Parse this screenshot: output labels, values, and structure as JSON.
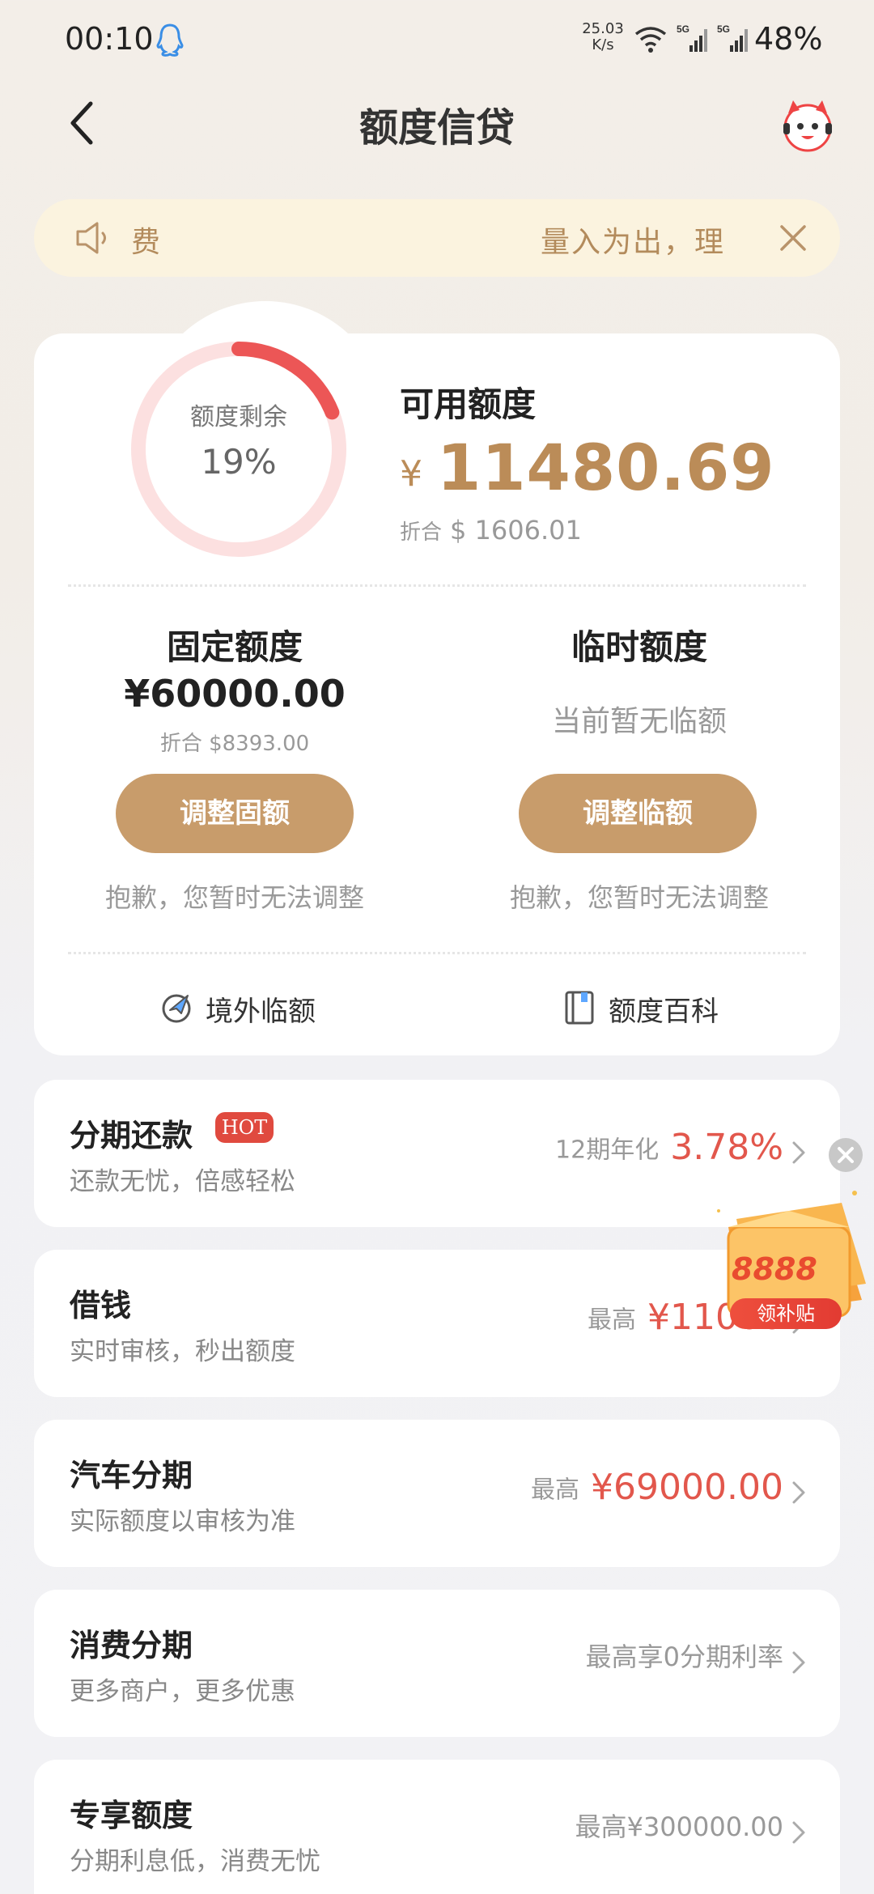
{
  "status_bar": {
    "time": "00:10",
    "speed_value": "25.03",
    "speed_unit": "K/s",
    "battery": "48%"
  },
  "header": {
    "title": "额度信贷"
  },
  "notice": {
    "left_text": "费",
    "right_text": "量入为出，理"
  },
  "credit": {
    "ring_label": "额度剩余",
    "ring_value": "19%",
    "ring_fraction": 0.19,
    "available_label": "可用额度",
    "available_currency": "¥",
    "available_amount": "11480.69",
    "converted_prefix": "折合",
    "available_converted": "$ 1606.01",
    "fixed_label": "固定额度",
    "fixed_amount": "¥60000.00",
    "fixed_converted": "折合 $8393.00",
    "temp_label": "临时额度",
    "temp_status": "当前暂无临额",
    "adjust_fixed_button": "调整固额",
    "adjust_temp_button": "调整临额",
    "adjust_fixed_note": "抱歉，您暂时无法调整",
    "adjust_temp_note": "抱歉，您暂时无法调整",
    "link_overseas": "境外临额",
    "link_encyclopedia": "额度百科"
  },
  "products": [
    {
      "title": "分期还款",
      "badge": "HOT",
      "subtitle": "还款无忧，倍感轻松",
      "prefix": "12期年化",
      "value": "3.78%"
    },
    {
      "title": "借钱",
      "subtitle": "实时审核，秒出额度",
      "prefix": "最高",
      "value": "¥11000"
    },
    {
      "title": "汽车分期",
      "subtitle": "实际额度以审核为准",
      "prefix": "最高",
      "value": "¥69000.00"
    },
    {
      "title": "消费分期",
      "subtitle": "更多商户，更多优惠",
      "plain": "最高享0分期利率"
    },
    {
      "title": "专享额度",
      "subtitle": "分期利息低，消费无忧",
      "plain": "最高¥300000.00"
    }
  ],
  "promo": {
    "amount": "8888",
    "cta": "领补贴"
  },
  "colors": {
    "accent_gold": "#bb8c58",
    "button_gold": "#c89c6b",
    "highlight_red": "#e2574c",
    "notice_bg": "#fbf3df"
  }
}
